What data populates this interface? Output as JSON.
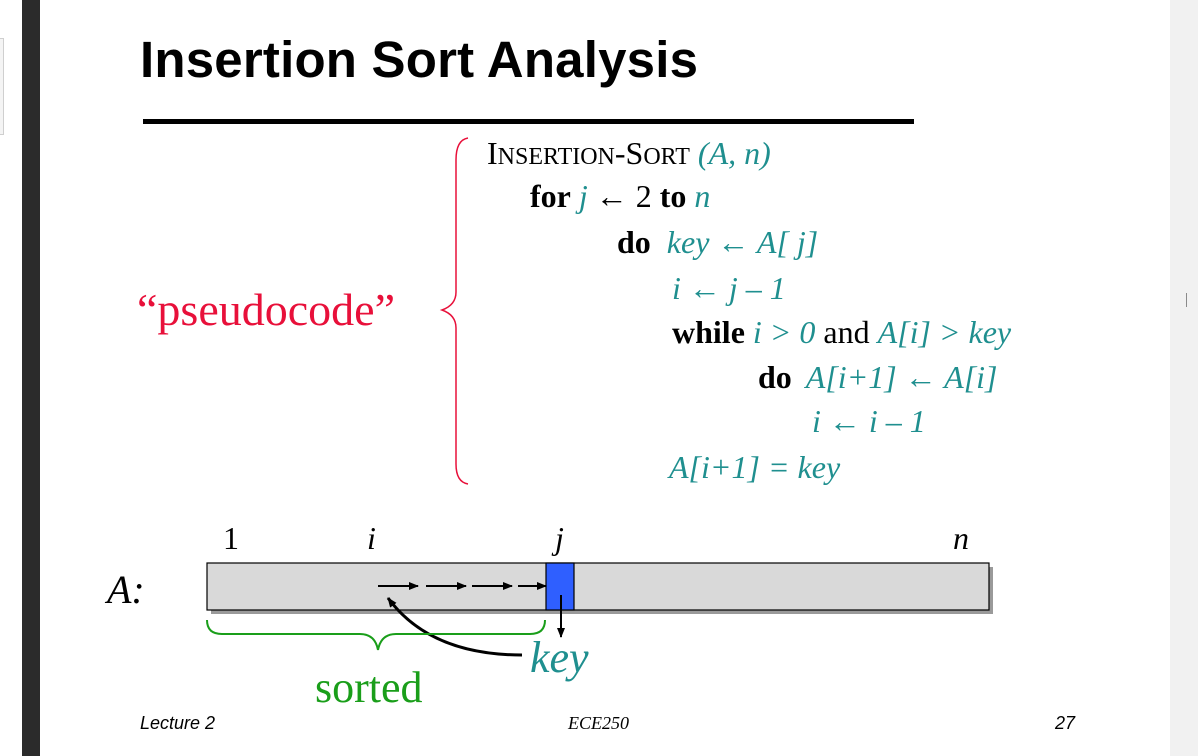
{
  "slide": {
    "title": "Insertion Sort Analysis",
    "pseudocode_label": "“pseudocode”",
    "code": {
      "proc_name_a": "I",
      "proc_name_b": "NSERTION",
      "proc_name_c": "-S",
      "proc_name_d": "ORT",
      "proc_params": "(A, n)",
      "line1_kw_for": "for",
      "line1_j": "j",
      "line1_arrow": "← 2",
      "line1_kw_to": "to",
      "line1_n": "n",
      "line2_kw_do": "do",
      "line2_body": "key ← A[ j]",
      "line3_body": "i ← j – 1",
      "line4_kw_while": "while",
      "line4_cond1": "i > 0",
      "line4_and": "and",
      "line4_cond2": "A[i] > key",
      "line5_kw_do": "do",
      "line5_body": "A[i+1] ← A[i]",
      "line6_body": "i ← i – 1",
      "line7_body": "A[i+1] = key"
    },
    "diagram": {
      "array_label": "A:",
      "index_1": "1",
      "index_i": "i",
      "index_j": "j",
      "index_n": "n",
      "sorted_label": "sorted",
      "key_label": "key"
    },
    "footer": {
      "left": "Lecture 2",
      "center": "ECE250",
      "right": "27"
    }
  },
  "colors": {
    "title": "#000000",
    "pseudocode_label": "#e8103a",
    "code_variables": "#1f8f8f",
    "brace": "#e8103a",
    "sorted": "#1a9e1a",
    "array_fill": "#d9d9d9",
    "key_cell": "#2f5fff"
  }
}
